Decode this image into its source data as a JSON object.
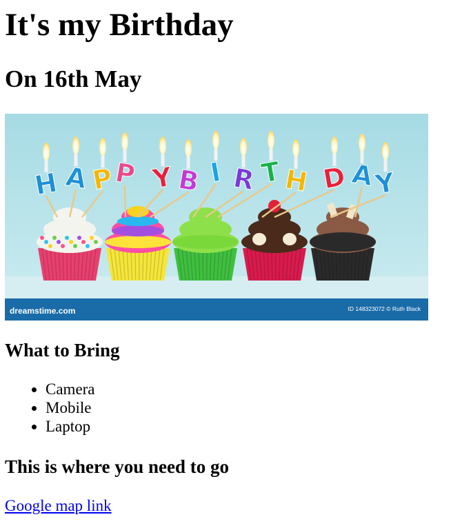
{
  "page": {
    "title": "It's my Birthday",
    "subtitle": "On 16th May"
  },
  "banner": {
    "image_alt": "Happy Birthday cupcakes with candles",
    "letters": [
      "H",
      "A",
      "P",
      "P",
      "Y",
      "B",
      "I",
      "R",
      "T",
      "H",
      "D",
      "A",
      "Y"
    ],
    "letter_colors": [
      "#1e90d6",
      "#1e90d6",
      "#f2b705",
      "#e84a8a",
      "#e8213a",
      "#c23ad6",
      "#1aa3e8",
      "#7b3ad6",
      "#17b24a",
      "#f2b705",
      "#e8213a",
      "#1e90d6",
      "#1e90d6"
    ],
    "footer_brand": "dreamstime.com",
    "footer_credit": "ID 148323072 © Ruth Black",
    "colors": {
      "background": "#a9dbe3",
      "footer": "#1a6ca8"
    },
    "cupcakes": [
      {
        "frosting": "#f4f4ef",
        "wrapper": "#e8406f",
        "topping": "sprinkles"
      },
      {
        "frosting": "#ff4fa3",
        "wrapper": "#f6e63a",
        "topping": "rainbow"
      },
      {
        "frosting": "#8ee04a",
        "wrapper": "#3fbf3f",
        "topping": "green"
      },
      {
        "frosting": "#4a2a1a",
        "wrapper": "#d81b4d",
        "topping": "cherry"
      },
      {
        "frosting": "#8a5a44",
        "wrapper": "#2a2a2a",
        "topping": "chocolate"
      }
    ]
  },
  "bring": {
    "heading": "What to Bring",
    "items": [
      "Camera",
      "Mobile",
      "Laptop"
    ]
  },
  "location": {
    "heading": "This is where you need to go",
    "link_text": "Google map link"
  }
}
